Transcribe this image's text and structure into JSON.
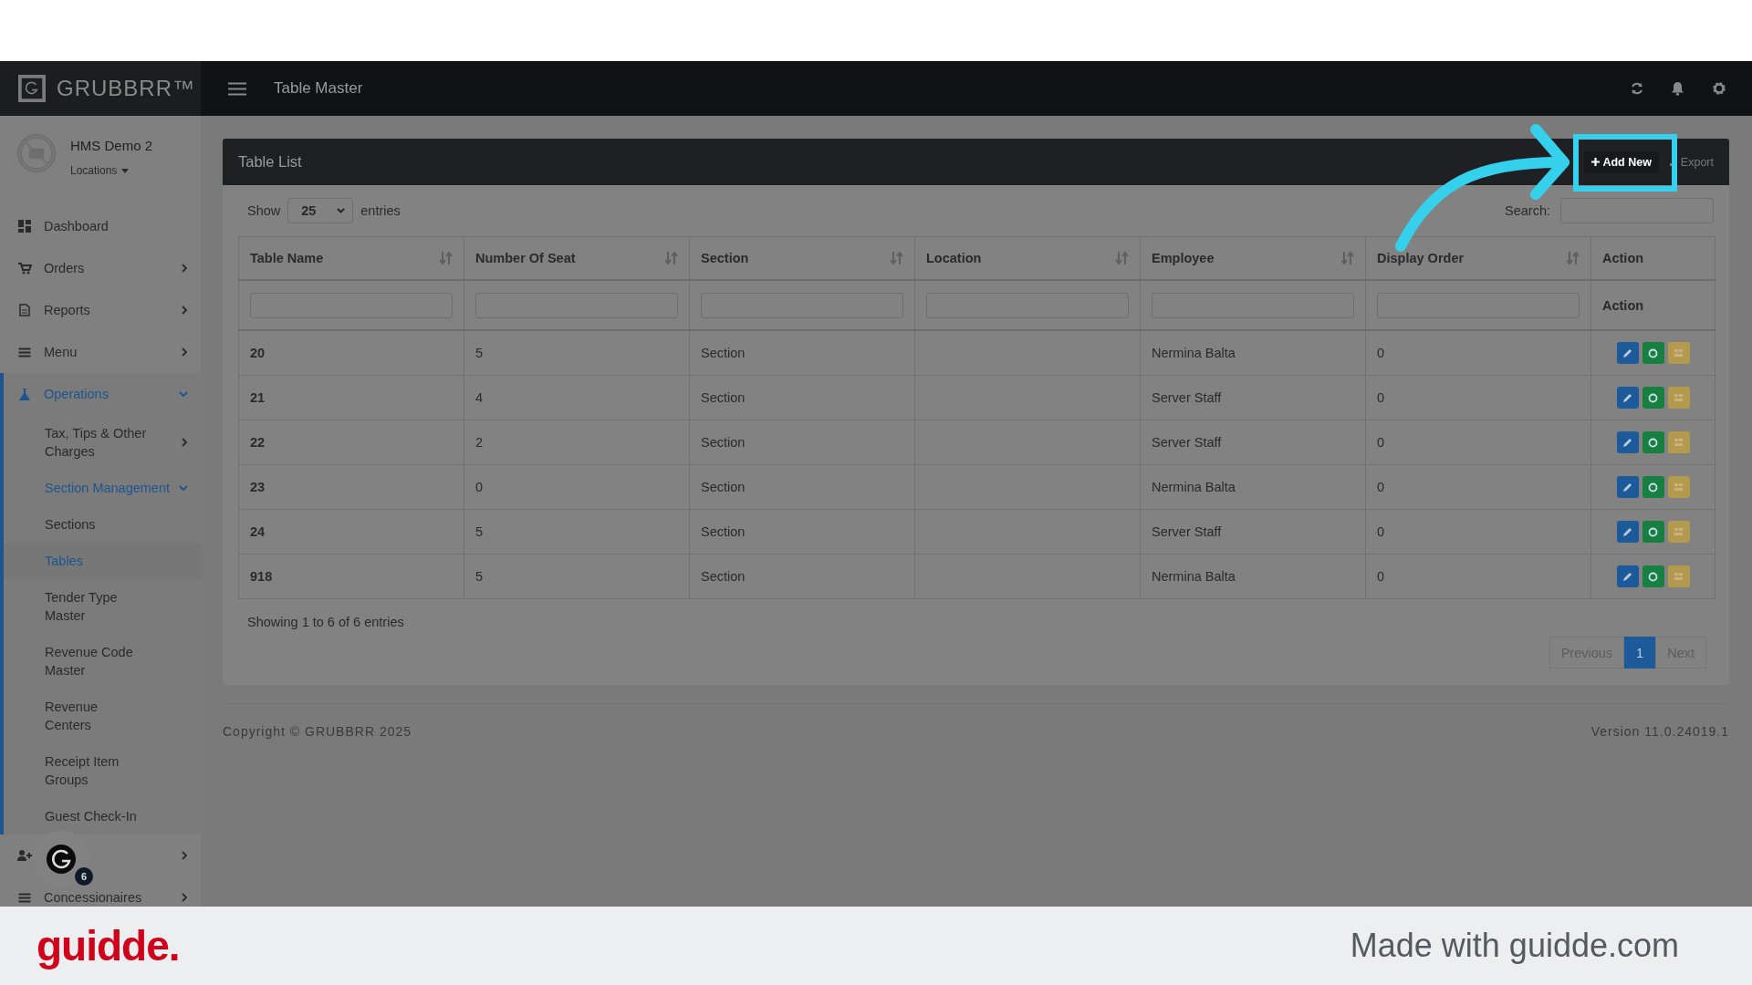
{
  "top_bar": {
    "logo": "GRUBBRR™",
    "title": "Table Master"
  },
  "profile": {
    "name": "HMS Demo 2",
    "locations": "Locations"
  },
  "sidebar": {
    "items": [
      {
        "label": "Dashboard",
        "kind": "link",
        "selected": false
      },
      {
        "label": "Orders",
        "kind": "group",
        "expanded": false,
        "selected": false
      },
      {
        "label": "Reports",
        "kind": "group",
        "expanded": false,
        "selected": false
      },
      {
        "label": "Menu",
        "kind": "group",
        "expanded": false,
        "selected": false
      },
      {
        "label": "Operations",
        "kind": "group",
        "expanded": true,
        "selected": true,
        "children": [
          {
            "label": "Tax, Tips & Other Charges",
            "kind": "group",
            "expanded": false,
            "selected": false
          },
          {
            "label": "Section Management",
            "kind": "group",
            "expanded": true,
            "selected": true,
            "children": [
              {
                "label": "Sections",
                "selected": false
              },
              {
                "label": "Tables",
                "selected": true
              }
            ]
          },
          {
            "label": "Tender Type Master",
            "kind": "link",
            "selected": false
          },
          {
            "label": "Revenue Code Master",
            "kind": "link",
            "selected": false
          },
          {
            "label": "Revenue Centers",
            "kind": "link",
            "selected": false
          },
          {
            "label": "Receipt Item Groups",
            "kind": "link",
            "selected": false
          },
          {
            "label": "Guest Check-In",
            "kind": "link",
            "selected": false
          }
        ]
      },
      {
        "kind": "group",
        "expanded": false,
        "selected": false
      },
      {
        "label": "Concessionaires",
        "kind": "group",
        "expanded": false,
        "selected": false
      }
    ]
  },
  "help_bubble": {
    "badge": "6"
  },
  "panel": {
    "title": "Table List",
    "add_button": "Add New",
    "export_button": "Export",
    "show_label": "Show",
    "page_size": "25",
    "entries_label": "entries",
    "search_label": "Search:",
    "table": {
      "columns": [
        {
          "label": "Table Name",
          "sortable": true,
          "filter": true
        },
        {
          "label": "Number Of Seat",
          "sortable": true,
          "filter": true
        },
        {
          "label": "Section",
          "sortable": true,
          "filter": true
        },
        {
          "label": "Location",
          "sortable": true,
          "filter": true
        },
        {
          "label": "Employee",
          "sortable": true,
          "filter": true
        },
        {
          "label": "Display Order",
          "sortable": true,
          "filter": true
        },
        {
          "label": "Action",
          "sortable": false,
          "filter": false,
          "filter_label": "Action"
        }
      ],
      "rows": [
        [
          "20",
          "5",
          "Section",
          "",
          "Nermina Balta",
          "0"
        ],
        [
          "21",
          "4",
          "Section",
          "",
          "Server Staff",
          "0"
        ],
        [
          "22",
          "2",
          "Section",
          "",
          "Server Staff",
          "0"
        ],
        [
          "23",
          "0",
          "Section",
          "",
          "Nermina Balta",
          "0"
        ],
        [
          "24",
          "5",
          "Section",
          "",
          "Server Staff",
          "0"
        ],
        [
          "918",
          "5",
          "Section",
          "",
          "Nermina Balta",
          "0"
        ]
      ]
    },
    "info": "Showing 1 to 6 of 6 entries",
    "pagination": [
      {
        "label": "Previous",
        "selected": false,
        "disabled": true
      },
      {
        "label": "1",
        "selected": true,
        "disabled": false
      },
      {
        "label": "Next",
        "selected": false,
        "disabled": true
      }
    ]
  },
  "footer": {
    "copyright": "Copyright © GRUBBRR 2025",
    "version": "Version 11.0.24019.1"
  },
  "guidde_bar": {
    "logo": "guidde.",
    "tagline": "Made with guidde.com"
  }
}
